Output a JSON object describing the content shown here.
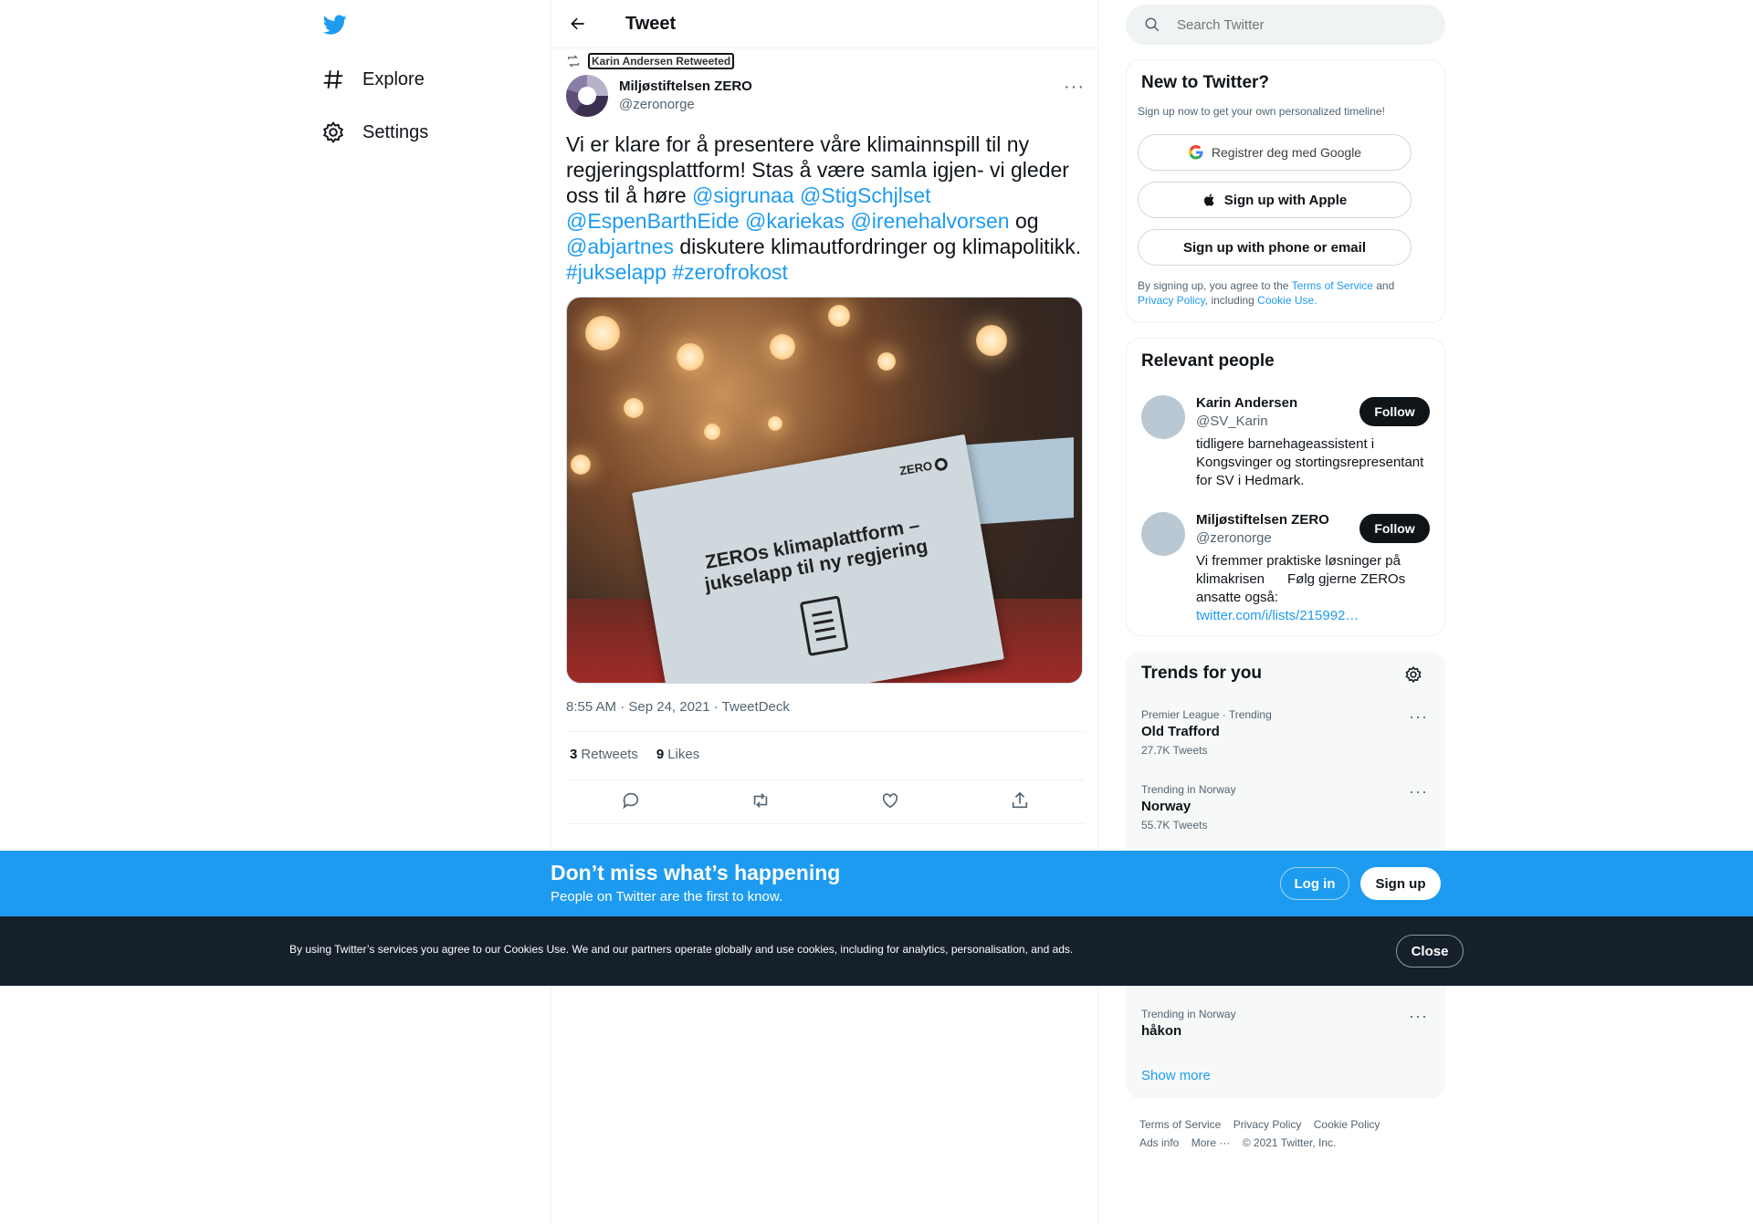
{
  "nav": {
    "items": [
      {
        "label": "Explore",
        "icon": "hashtag-icon"
      },
      {
        "label": "Settings",
        "icon": "gear-icon"
      }
    ]
  },
  "main": {
    "header_title": "Tweet",
    "retweeted_by": "Karin Andersen Retweeted",
    "author": {
      "name": "Miljøstiftelsen ZERO",
      "handle": "@zeronorge"
    },
    "text": {
      "part1": "Vi er klare for å presentere våre klimainnspill til ny regjeringsplattform! Stas å være samla igjen- vi gleder oss til å høre ",
      "m1": "@sigrunaa",
      "m2": "@StigSchjlset",
      "m3": "@EspenBarthEide",
      "m4": "@kariekas",
      "m5": "@irenehalvorsen",
      "og": "og",
      "m6": "@abjartnes",
      "part2": " diskutere klimautfordringer og klimapolitikk. ",
      "h1": "#jukselapp",
      "h2": "#zerofrokost"
    },
    "media": {
      "card_logo": "ZERO",
      "card_title": "ZEROs klimaplattform – jukselapp til ny regjering"
    },
    "meta": "8:55 AM · Sep 24, 2021 · TweetDeck",
    "stats": {
      "retweets_count": "3",
      "retweets_label": "Retweets",
      "likes_count": "9",
      "likes_label": "Likes"
    }
  },
  "sidebar": {
    "search_placeholder": "Search Twitter",
    "new_to_twitter": {
      "title": "New to Twitter?",
      "subtitle": "Sign up now to get your own personalized timeline!",
      "google": "Registrer deg med Google",
      "apple": "Sign up with Apple",
      "phone": "Sign up with phone or email",
      "terms_pre": "By signing up, you agree to the ",
      "terms_link": "Terms of Service",
      "terms_and": " and ",
      "privacy_link": "Privacy Policy",
      "terms_including": ", including ",
      "cookie_link": "Cookie Use."
    },
    "relevant": {
      "title": "Relevant people",
      "people": [
        {
          "name": "Karin Andersen",
          "handle": "@SV_Karin",
          "bio": "tidligere barnehageassistent i Kongsvinger og stortingsrepresentant for SV i Hedmark.",
          "follow": "Follow"
        },
        {
          "name": "Miljøstiftelsen ZERO",
          "handle": "@zeronorge",
          "bio": "Vi fremmer praktiske løsninger på klimakrisen      Følg gjerne ZEROs ansatte også: ",
          "link": "twitter.com/i/lists/215992…",
          "follow": "Follow"
        }
      ]
    },
    "trends": {
      "title": "Trends for you",
      "items": [
        {
          "category": "Premier League · Trending",
          "name": "Old Trafford",
          "count": "27.7K Tweets"
        },
        {
          "category": "Trending in Norway",
          "name": "Norway",
          "count": "55.7K Tweets"
        },
        {
          "category": "Trending in Norway",
          "name": "håkon",
          "count": ""
        }
      ],
      "show_more": "Show more"
    },
    "footer": {
      "tos": "Terms of Service",
      "privacy": "Privacy Policy",
      "cookie": "Cookie Policy",
      "ads": "Ads info",
      "more": "More ···",
      "copyright": "© 2021 Twitter, Inc."
    }
  },
  "promo": {
    "title": "Don’t miss what’s happening",
    "subtitle": "People on Twitter are the first to know.",
    "login": "Log in",
    "signup": "Sign up"
  },
  "cookie": {
    "text": "By using Twitter’s services you agree to our Cookies Use. We and our partners operate globally and use cookies, including for analytics, personalisation, and ads.",
    "close": "Close"
  },
  "colors": {
    "accent": "#1d9bf0",
    "dark": "#0f1419",
    "muted": "#536471",
    "cookie_bg": "#15202b"
  }
}
